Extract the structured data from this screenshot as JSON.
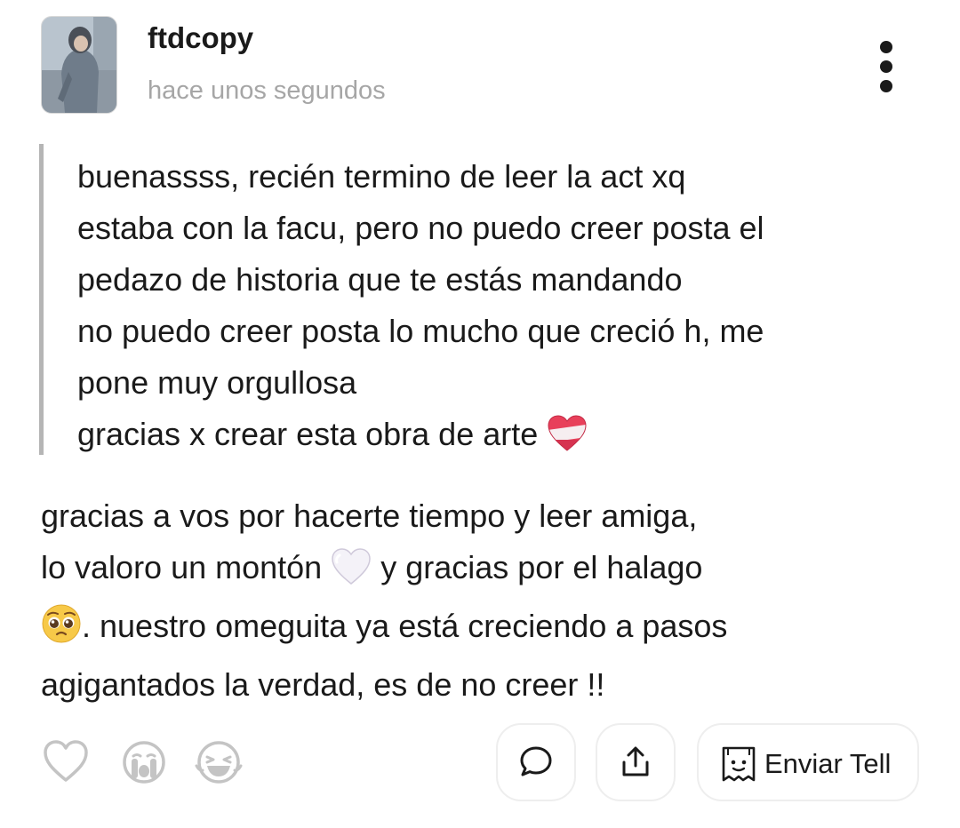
{
  "post": {
    "username": "ftdcopy",
    "timestamp": "hace unos segundos",
    "more_icon": "vertical-ellipsis-icon"
  },
  "quote": {
    "lines": [
      "buenassss, recién termino de leer la act xq",
      "estaba con la facu, pero no puedo creer posta el",
      "pedazo de historia que te estás mandando",
      "no puedo creer posta lo mucho que creció h, me",
      "pone muy orgullosa",
      "gracias x crear esta obra de arte"
    ],
    "emoji": "healing-heart"
  },
  "reply": {
    "line1": "gracias a vos por hacerte tiempo y leer amiga,",
    "line2_before": "lo valoro un montón",
    "line2_emoji": "white-heart",
    "line2_after": "y gracias por el halago",
    "line3_emoji": "pleading-face",
    "line3_text": ". nuestro omeguita ya está creciendo a pasos",
    "line4": "agigantados la verdad, es de no creer !!"
  },
  "reactions": [
    {
      "icon": "heart-outline-icon"
    },
    {
      "icon": "crying-face-icon"
    },
    {
      "icon": "laughing-face-icon"
    }
  ],
  "actions": {
    "comment_icon": "speech-bubble-icon",
    "share_icon": "share-upload-icon",
    "tell_icon": "paper-ghost-icon",
    "tell_label": "Enviar Tell"
  },
  "colors": {
    "text": "#1a1a1a",
    "muted": "#a6a6a6",
    "quote_bar": "#b5b5b5",
    "icon_gray": "#c4c4c4",
    "button_border": "#eeeeee"
  }
}
